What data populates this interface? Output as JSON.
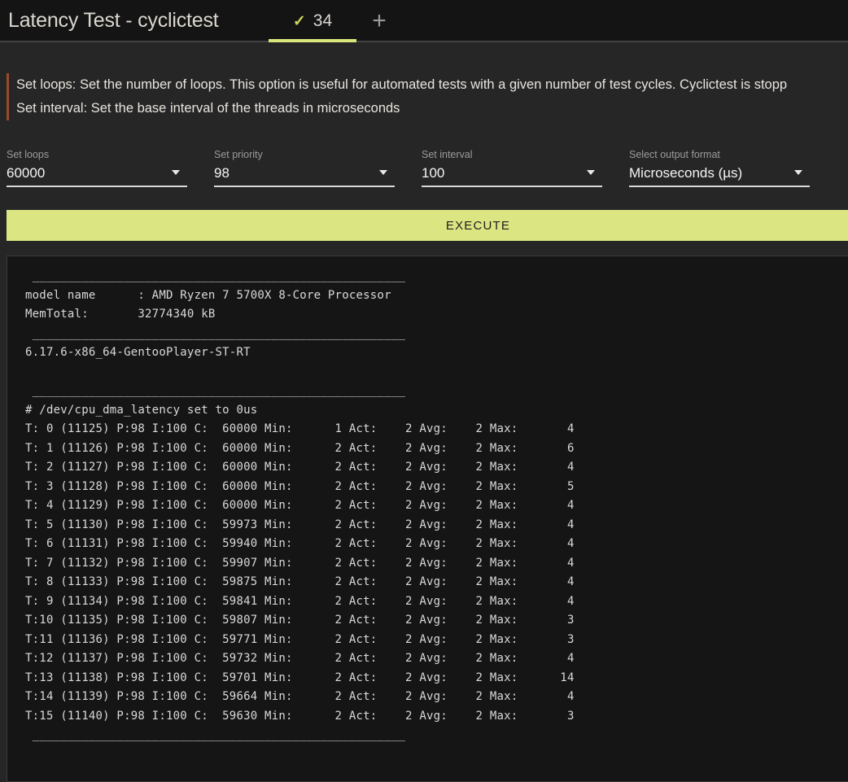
{
  "header": {
    "title": "Latency Test - cyclictest",
    "tab": {
      "check_icon": "✓",
      "count": "34"
    },
    "add_tab_label": "+"
  },
  "info": {
    "lines": [
      "Set loops: Set the number of loops. This option is useful for automated tests with a given number of test cycles. Cyclictest is stopp",
      "Set interval: Set the base interval of the threads in microseconds"
    ]
  },
  "form": {
    "fields": [
      {
        "label": "Set loops",
        "value": "60000"
      },
      {
        "label": "Set priority",
        "value": "98"
      },
      {
        "label": "Set interval",
        "value": "100"
      },
      {
        "label": "Select output format",
        "value": "Microseconds (µs)"
      }
    ],
    "execute_label": "EXECUTE"
  },
  "terminal": {
    "lines": [
      " _____________________________________________________",
      "model name      : AMD Ryzen 7 5700X 8-Core Processor",
      "MemTotal:       32774340 kB",
      " _____________________________________________________",
      "6.17.6-x86_64-GentooPlayer-ST-RT",
      "",
      " _____________________________________________________",
      "# /dev/cpu_dma_latency set to 0us",
      "T: 0 (11125) P:98 I:100 C:  60000 Min:      1 Act:    2 Avg:    2 Max:       4",
      "T: 1 (11126) P:98 I:100 C:  60000 Min:      2 Act:    2 Avg:    2 Max:       6",
      "T: 2 (11127) P:98 I:100 C:  60000 Min:      2 Act:    2 Avg:    2 Max:       4",
      "T: 3 (11128) P:98 I:100 C:  60000 Min:      2 Act:    2 Avg:    2 Max:       5",
      "T: 4 (11129) P:98 I:100 C:  60000 Min:      2 Act:    2 Avg:    2 Max:       4",
      "T: 5 (11130) P:98 I:100 C:  59973 Min:      2 Act:    2 Avg:    2 Max:       4",
      "T: 6 (11131) P:98 I:100 C:  59940 Min:      2 Act:    2 Avg:    2 Max:       4",
      "T: 7 (11132) P:98 I:100 C:  59907 Min:      2 Act:    2 Avg:    2 Max:       4",
      "T: 8 (11133) P:98 I:100 C:  59875 Min:      2 Act:    2 Avg:    2 Max:       4",
      "T: 9 (11134) P:98 I:100 C:  59841 Min:      2 Act:    2 Avg:    2 Max:       4",
      "T:10 (11135) P:98 I:100 C:  59807 Min:      2 Act:    2 Avg:    2 Max:       3",
      "T:11 (11136) P:98 I:100 C:  59771 Min:      2 Act:    2 Avg:    2 Max:       3",
      "T:12 (11137) P:98 I:100 C:  59732 Min:      2 Act:    2 Avg:    2 Max:       4",
      "T:13 (11138) P:98 I:100 C:  59701 Min:      2 Act:    2 Avg:    2 Max:      14",
      "T:14 (11139) P:98 I:100 C:  59664 Min:      2 Act:    2 Avg:    2 Max:       4",
      "T:15 (11140) P:98 I:100 C:  59630 Min:      2 Act:    2 Avg:    2 Max:       3",
      " _____________________________________________________"
    ]
  },
  "colors": {
    "accent": "#dbe682",
    "tab_underline": "#d9e47a",
    "info_border": "#9c4a2f",
    "header_bg": "#141414",
    "page_bg": "#262626",
    "terminal_bg": "#151515",
    "terminal_text": "#d9d9d9"
  }
}
